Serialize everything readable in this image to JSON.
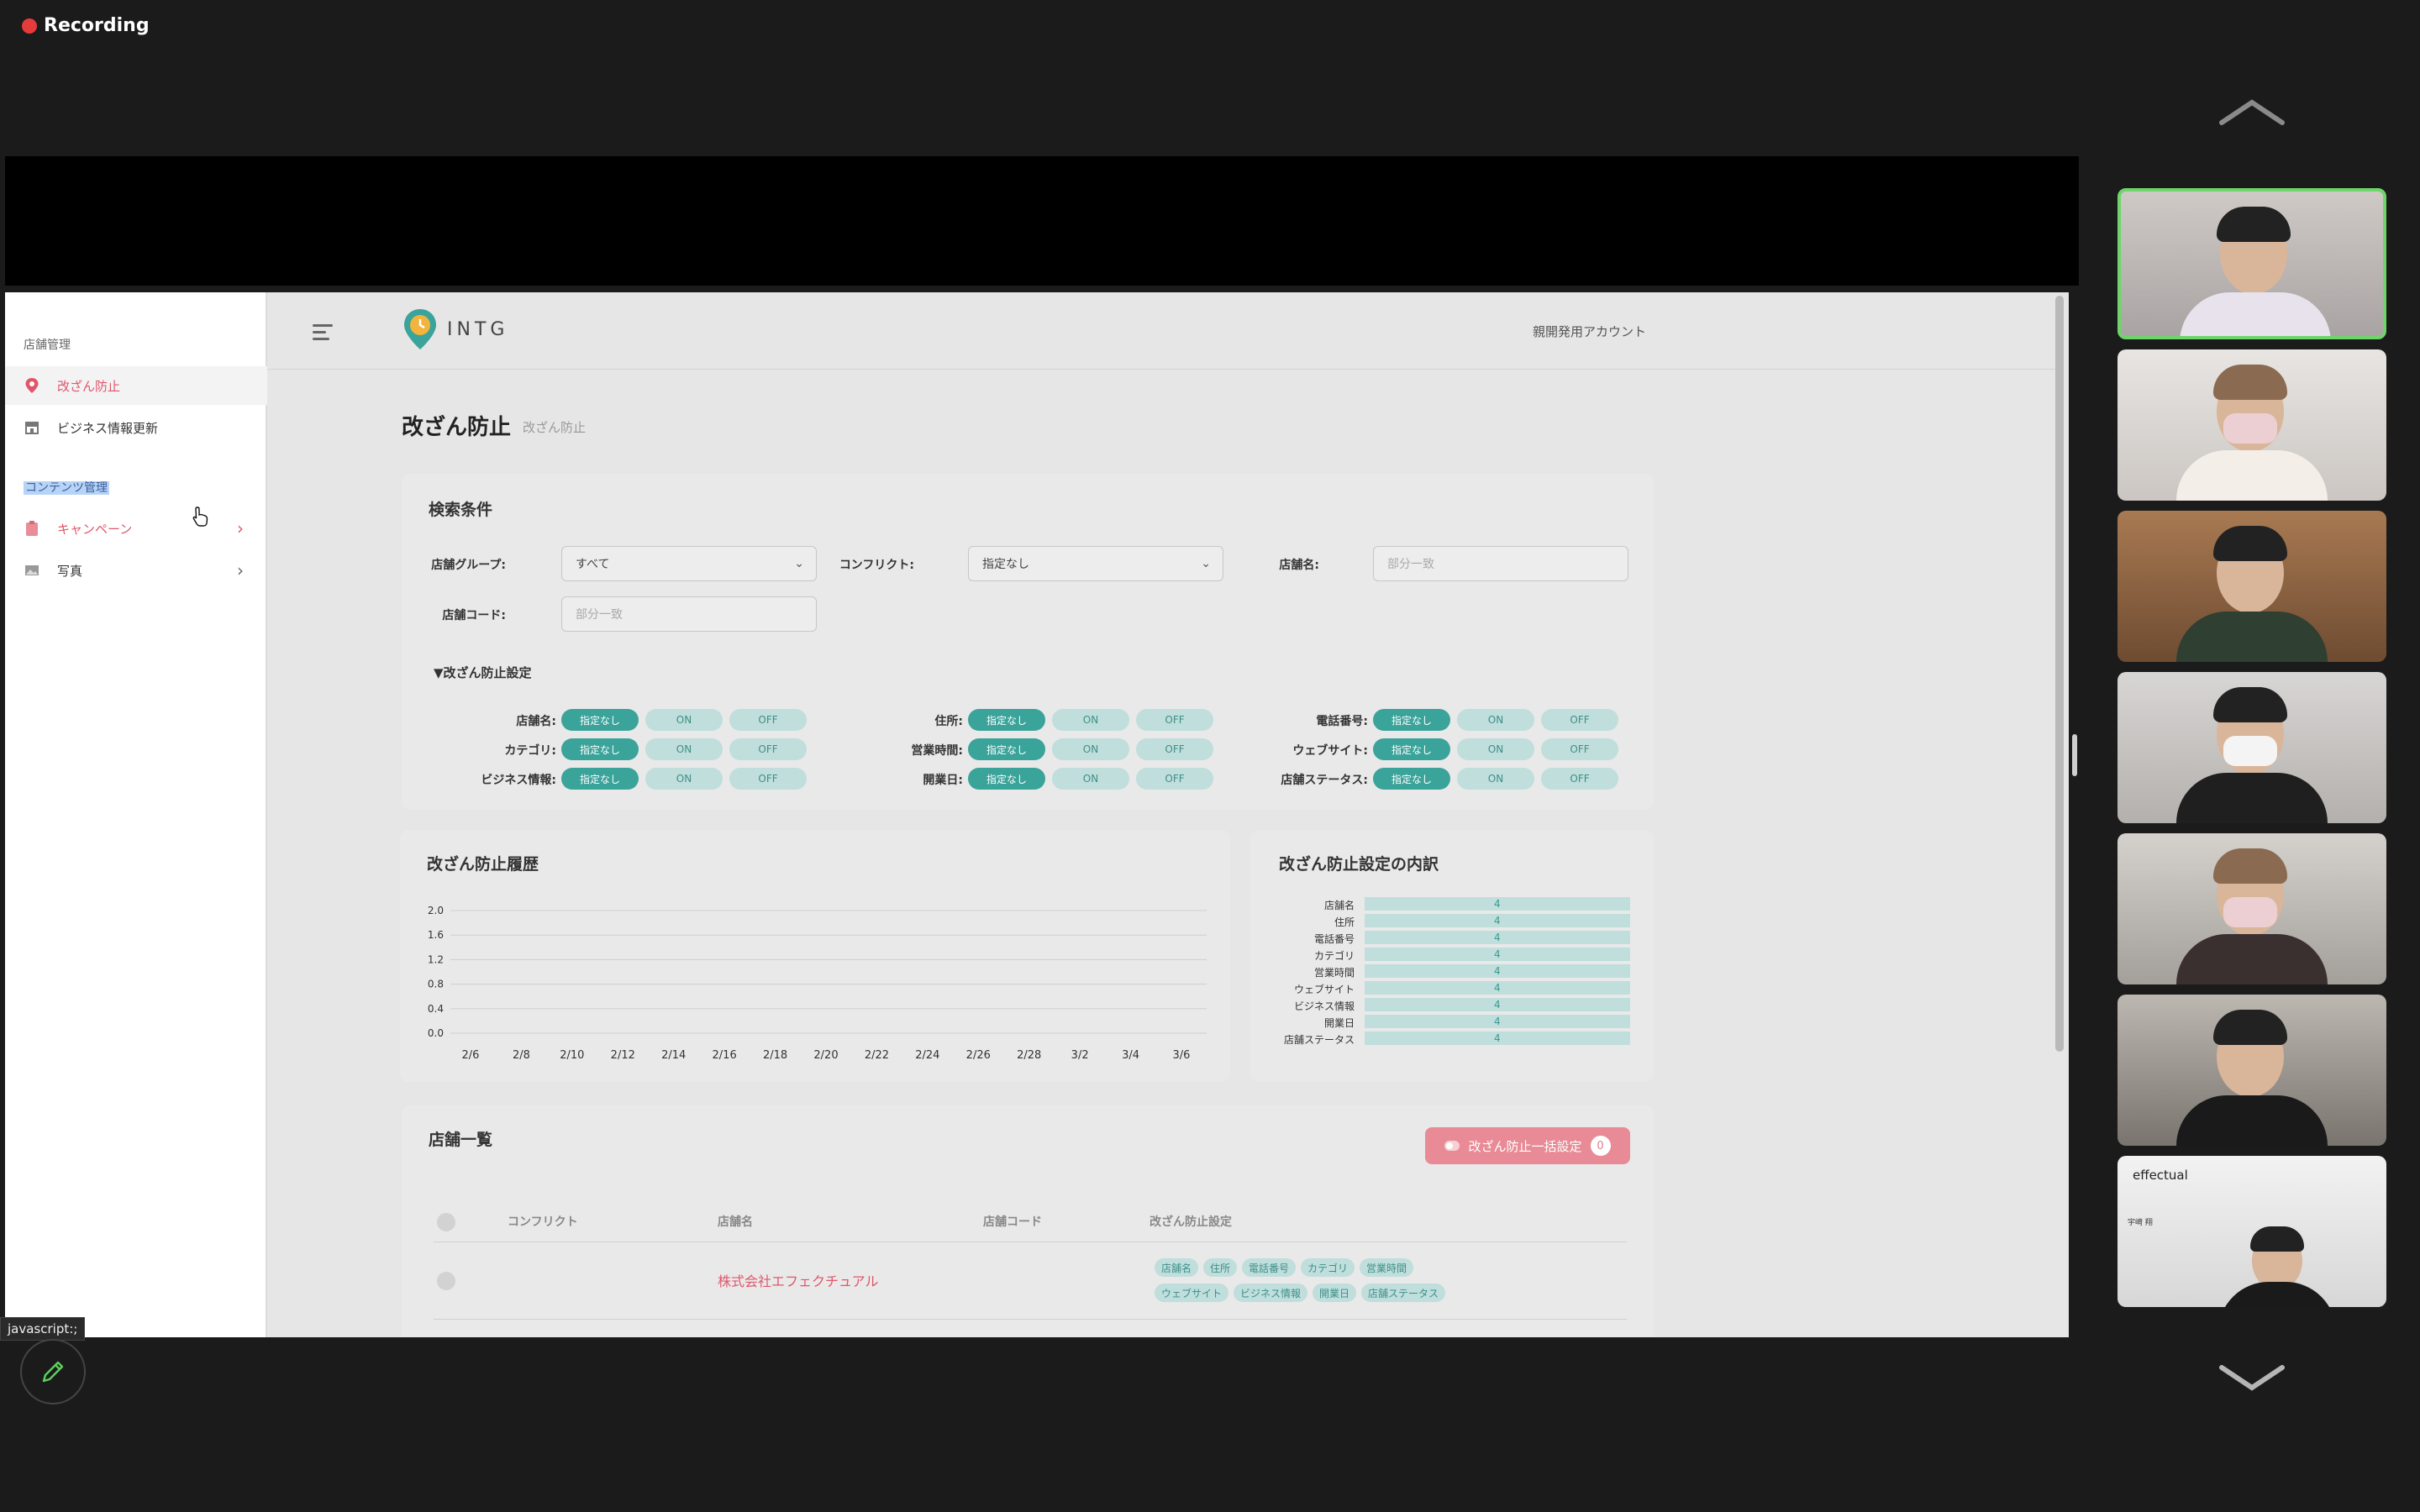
{
  "recording": {
    "label": "Recording"
  },
  "sidebar": {
    "section_store": "店舗管理",
    "items_store": [
      {
        "label": "改ざん防止",
        "icon": "pin-icon"
      },
      {
        "label": "ビジネス情報更新",
        "icon": "store-icon"
      }
    ],
    "section_content": "コンテンツ管理",
    "items_content": [
      {
        "label": "キャンペーン",
        "icon": "clipboard-icon"
      },
      {
        "label": "写真",
        "icon": "photo-icon"
      }
    ]
  },
  "header": {
    "logo": "INTG",
    "account": "親開発用アカウント"
  },
  "page": {
    "title": "改ざん防止",
    "subtitle": "改ざん防止"
  },
  "search": {
    "title": "検索条件",
    "fields": {
      "group_label": "店舗グループ:",
      "group_value": "すべて",
      "conflict_label": "コンフリクト:",
      "conflict_value": "指定なし",
      "name_label": "店舗名:",
      "name_placeholder": "部分一致",
      "code_label": "店舗コード:",
      "code_placeholder": "部分一致"
    },
    "toggle_heading": "▼改ざん防止設定",
    "toggles": [
      {
        "label": "店舗名:"
      },
      {
        "label": "住所:"
      },
      {
        "label": "電話番号:"
      },
      {
        "label": "カテゴリ:"
      },
      {
        "label": "営業時間:"
      },
      {
        "label": "ウェブサイト:"
      },
      {
        "label": "ビジネス情報:"
      },
      {
        "label": "開業日:"
      },
      {
        "label": "店舗ステータス:"
      }
    ],
    "pill_none": "指定なし",
    "pill_on": "ON",
    "pill_off": "OFF"
  },
  "chart_data": [
    {
      "type": "line",
      "title": "改ざん防止履歴",
      "x": [
        "2/6",
        "2/8",
        "2/10",
        "2/12",
        "2/14",
        "2/16",
        "2/18",
        "2/20",
        "2/22",
        "2/24",
        "2/26",
        "2/28",
        "3/2",
        "3/4",
        "3/6"
      ],
      "yticks": [
        "2.0",
        "1.6",
        "1.2",
        "0.8",
        "0.4",
        "0.0"
      ],
      "ylim": [
        0,
        2
      ],
      "series": [],
      "grid": true
    },
    {
      "type": "bar",
      "orientation": "horizontal",
      "title": "改ざん防止設定の内訳",
      "categories": [
        "店舗名",
        "住所",
        "電話番号",
        "カテゴリ",
        "営業時間",
        "ウェブサイト",
        "ビジネス情報",
        "開業日",
        "店舗ステータス"
      ],
      "values": [
        4,
        4,
        4,
        4,
        4,
        4,
        4,
        4,
        4
      ],
      "xlim": [
        0,
        4
      ]
    }
  ],
  "stores": {
    "title": "店舗一覧",
    "bulk_button": "改ざん防止一括設定",
    "bulk_count": "0",
    "columns": [
      "コンフリクト",
      "店舗名",
      "店舗コード",
      "改ざん防止設定"
    ],
    "rows": [
      {
        "conflict": "",
        "name": "株式会社エフェクチュアル",
        "code": "",
        "tags": [
          "店舗名",
          "住所",
          "電話番号",
          "カテゴリ",
          "営業時間",
          "ウェブサイト",
          "ビジネス情報",
          "開業日",
          "店舗ステータス"
        ]
      }
    ]
  },
  "status_url": "javascript:;",
  "participants": {
    "count": 7,
    "last_tile_brand": "effectual",
    "last_tile_name": "宇﨑 翔"
  }
}
